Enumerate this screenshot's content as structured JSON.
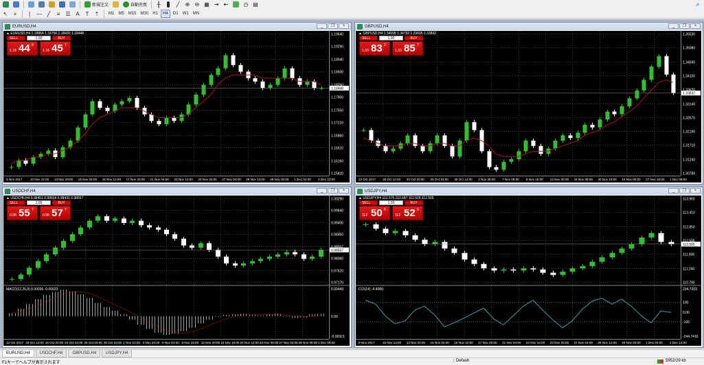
{
  "toolbar": {
    "new_order": "新規注文",
    "auto_trading": "自動売買",
    "timeframes": [
      "M1",
      "M5",
      "M15",
      "M30",
      "H1",
      "H4",
      "D1",
      "W1",
      "MN"
    ]
  },
  "colors": {
    "up": "#2fbf2f",
    "down": "#ffffff",
    "ma": "#b01818",
    "cci": "#2aa6a6",
    "macd": "#cfcfcf",
    "grid": "#3a3a3a",
    "price_line": "#ffffff"
  },
  "charts": [
    {
      "title": "EURUSD,H4",
      "symbol_line": "▲ EURUSD,H4  1.18864 1.18756 1.18430 1.18448",
      "trade": {
        "sell": "SELL",
        "buy": "BUY",
        "lot": "1.00",
        "bid_small": "1.18",
        "bid_big": "44",
        "bid_sup": "8",
        "ask_small": "1.18",
        "ask_big": "45",
        "ask_sup": "7"
      },
      "current_price": "1.18448",
      "price_labels": [
        "1.19640",
        "1.19290",
        "1.18940",
        "1.18600",
        "1.18250",
        "1.17900",
        "1.17550",
        "1.17210",
        "1.16860",
        "1.16510",
        "1.16160",
        "1.15820"
      ],
      "time_labels": [
        "9 Nov 2017",
        "10 Nov 12:00",
        "13 Nov 20:00",
        "15 Nov 04:00",
        "16 Nov 12:00",
        "17 Nov 20:00",
        "21 Nov 04:00",
        "22 Nov 12:00",
        "23 Nov 20:00",
        "27 Nov 04:00",
        "28 Nov 12:00",
        "29 Nov 20:00",
        "1 Dec 04:00",
        "4 Dec 12:00"
      ],
      "chart_data": {
        "type": "candlestick",
        "series": [
          {
            "name": "",
            "values": [
              1.16,
              1.162,
              1.161,
              1.163,
              1.164,
              1.165,
              1.163,
              1.166,
              1.168,
              1.172,
              1.176,
              1.18,
              1.178,
              1.177,
              1.179,
              1.18,
              1.181,
              1.178,
              1.176,
              1.174,
              1.173,
              1.175,
              1.174,
              1.176,
              1.179,
              1.182,
              1.185,
              1.188,
              1.19,
              1.194,
              1.191,
              1.189,
              1.187,
              1.186,
              1.184,
              1.185,
              1.187,
              1.19,
              1.187,
              1.185,
              1.186,
              1.184,
              1.184
            ]
          }
        ],
        "ma": [
          1.161,
          1.162,
          1.162,
          1.163,
          1.163,
          1.164,
          1.164,
          1.165,
          1.166,
          1.168,
          1.17,
          1.173,
          1.175,
          1.176,
          1.177,
          1.178,
          1.178,
          1.178,
          1.177,
          1.176,
          1.175,
          1.175,
          1.175,
          1.175,
          1.176,
          1.178,
          1.18,
          1.182,
          1.185,
          1.187,
          1.188,
          1.188,
          1.188,
          1.188,
          1.187,
          1.187,
          1.187,
          1.187,
          1.187,
          1.186,
          1.186,
          1.186,
          1.185
        ],
        "ylim": [
          1.1582,
          1.1964
        ]
      }
    },
    {
      "title": "GBPUSD,H4",
      "symbol_line": "▲ GBPUSD,H4  1.34098 1.34792 1.33695 1.33832",
      "trade": {
        "sell": "SELL",
        "buy": "BUY",
        "lot": "1.00",
        "bid_small": "1.33",
        "bid_big": "83",
        "bid_sup": "2",
        "ask_small": "1.33",
        "ask_big": "85",
        "ask_sup": "7"
      },
      "current_price": "1.33832",
      "price_labels": [
        "1.35530",
        "1.35080",
        "1.34590",
        "1.34100",
        "1.33620",
        "1.33140",
        "1.32670",
        "1.32190",
        "1.31710",
        "1.31240",
        "1.30780"
      ],
      "time_labels": [
        "13 Oct 2017",
        "18 Oct 12:00",
        "23 Oct 20:00",
        "25 Oct 16:00",
        "30 Oct 12:00",
        "2 Nov 00:00",
        "7 Nov 08:00",
        "9 Nov 16:00",
        "14 Nov 00:00",
        "16 Nov 08:00",
        "20 Nov 16:00",
        "24 Nov 00:00",
        "27 Nov 16:00",
        "1 Dec 08:00"
      ],
      "chart_data": {
        "type": "candlestick",
        "series": [
          {
            "name": "",
            "values": [
              1.324,
              1.32,
              1.318,
              1.316,
              1.317,
              1.319,
              1.322,
              1.318,
              1.316,
              1.319,
              1.322,
              1.318,
              1.314,
              1.32,
              1.327,
              1.324,
              1.316,
              1.31,
              1.309,
              1.312,
              1.313,
              1.316,
              1.32,
              1.318,
              1.315,
              1.317,
              1.32,
              1.322,
              1.321,
              1.323,
              1.326,
              1.325,
              1.328,
              1.331,
              1.33,
              1.333,
              1.336,
              1.339,
              1.343,
              1.348,
              1.352,
              1.345,
              1.338
            ]
          }
        ],
        "ma": [
          1.321,
          1.32,
          1.319,
          1.318,
          1.318,
          1.318,
          1.319,
          1.319,
          1.318,
          1.318,
          1.319,
          1.319,
          1.318,
          1.318,
          1.32,
          1.321,
          1.32,
          1.318,
          1.315,
          1.314,
          1.314,
          1.314,
          1.315,
          1.316,
          1.316,
          1.316,
          1.317,
          1.318,
          1.319,
          1.32,
          1.322,
          1.323,
          1.324,
          1.326,
          1.327,
          1.329,
          1.331,
          1.333,
          1.336,
          1.339,
          1.342,
          1.343,
          1.342
        ],
        "ylim": [
          1.3078,
          1.3553
        ]
      }
    },
    {
      "title": "USDCHF,H4",
      "symbol_line": "▲ USDCHF,H4  0.98451 0.98604 0.98431 0.98557",
      "trade": {
        "sell": "SELL",
        "buy": "BUY",
        "lot": "1.00",
        "bid_small": "0.98",
        "bid_big": "55",
        "bid_sup": "7",
        "ask_small": "0.98",
        "ask_big": "57",
        "ask_sup": "7"
      },
      "current_price": "0.98557",
      "price_labels": [
        "1.00290",
        "0.99840",
        "0.99400",
        "0.98950",
        "0.98557",
        "0.98060",
        "0.97620",
        "0.97170"
      ],
      "macd_label": "MACD(12,26,9) 0.00036 -0.00023",
      "macd_levels": [
        "0.00449",
        "0.00",
        "-0.00321"
      ],
      "time_labels": [
        "13 Oct 2017",
        "18 Oct 12:00",
        "19 Oct 20:00",
        "23 Oct 04:00",
        "25 Oct 20:00",
        "30 Oct 04:00",
        "1 Nov 12:00",
        "3 Nov 20:00",
        "6 Nov 04:00",
        "9 Nov 16:00",
        "13 Nov 20:00",
        "16 Nov 16:00",
        "20 Nov 12:00",
        "23 Nov 08:00",
        "27 Nov 04:00",
        "29 Nov 08:00",
        "1 Dec 08:00"
      ],
      "chart_data": {
        "type": "candlestick",
        "series": [
          {
            "name": "",
            "values": [
              0.973,
              0.975,
              0.978,
              0.981,
              0.984,
              0.987,
              0.99,
              0.993,
              0.996,
              0.999,
              1.001,
              0.999,
              1.0,
              0.998,
              0.999,
              0.997,
              0.996,
              0.995,
              0.993,
              0.991,
              0.988,
              0.987,
              0.989,
              0.986,
              0.983,
              0.98,
              0.979,
              0.98,
              0.981,
              0.982,
              0.983,
              0.984,
              0.985,
              0.984,
              0.982,
              0.983,
              0.986
            ]
          }
        ],
        "macd": [
          0.0005,
          0.0012,
          0.002,
          0.0028,
          0.0035,
          0.004,
          0.0044,
          0.0041,
          0.0036,
          0.003,
          0.0022,
          0.0015,
          0.0009,
          0.0003,
          -0.0006,
          -0.0014,
          -0.0021,
          -0.0027,
          -0.0031,
          -0.0029,
          -0.0025,
          -0.0019,
          -0.0012,
          -0.0006,
          -0.0001,
          0.0002,
          0.0003,
          0.0004,
          0.0002,
          0.0001,
          0.0003,
          0.0004,
          -0.0001,
          -0.0003,
          -0.0002,
          0.0003,
          0.0004
        ],
        "ylim": [
          0.9717,
          1.0029
        ]
      }
    },
    {
      "title": "USDJPY,H4",
      "symbol_line": "▲ USDJPY,H4  112.575 112.687 112.505 112.505",
      "trade": {
        "sell": "SELL",
        "buy": "BUY",
        "lot": "1.00",
        "bid_small": "112",
        "bid_big": "50",
        "bid_sup": "5",
        "ask_small": "112",
        "ask_big": "52",
        "ask_sup": "5"
      },
      "current_price": "112.505",
      "price_labels": [
        "113.960",
        "113.410",
        "112.850",
        "112.505",
        "111.800",
        "111.240",
        "110.780"
      ],
      "cci_label": "CCI(14) -4.4080",
      "cci_levels": [
        "234.7203",
        "100",
        "0.00",
        "-100",
        "-244.7416"
      ],
      "time_labels": [
        "9 Nov 2017",
        "10 Nov 12:00",
        "13 Nov 20:00",
        "15 Nov 04:00",
        "16 Nov 12:00",
        "17 Nov 20:00",
        "21 Nov 04:00",
        "22 Nov 12:00",
        "23 Nov 20:00",
        "27 Nov 04:00",
        "28 Nov 12:00",
        "29 Nov 20:00",
        "1 Dec 04:00",
        "4 Dec 12:00"
      ],
      "chart_data": {
        "type": "candlestick",
        "series": [
          {
            "name": "",
            "values": [
              113.4,
              113.2,
              113.0,
              113.1,
              112.9,
              112.7,
              112.5,
              112.6,
              112.3,
              112.1,
              111.8,
              111.6,
              111.4,
              111.3,
              111.35,
              111.3,
              111.4,
              111.35,
              111.2,
              111.1,
              111.25,
              111.4,
              111.5,
              111.7,
              111.9,
              112.1,
              112.3,
              112.5,
              112.8,
              113.0,
              112.6,
              112.5
            ]
          }
        ],
        "cci": [
          120,
          80,
          -40,
          -120,
          -90,
          20,
          60,
          -30,
          -150,
          -110,
          -60,
          -10,
          40,
          -70,
          -130,
          -40,
          60,
          120,
          20,
          -80,
          -160,
          -90,
          30,
          110,
          140,
          80,
          130,
          60,
          -40,
          -110,
          10,
          -4
        ],
        "ylim": [
          110.78,
          113.96
        ]
      }
    }
  ],
  "tabs": [
    "EURUSD,H4",
    "USDCHF,H4",
    "GBPUSD,H4",
    "USDJPY,H4"
  ],
  "status": {
    "hint": "F1キーでヘルプが表示されます",
    "profile": "Default",
    "net": "5952/29 kb"
  }
}
